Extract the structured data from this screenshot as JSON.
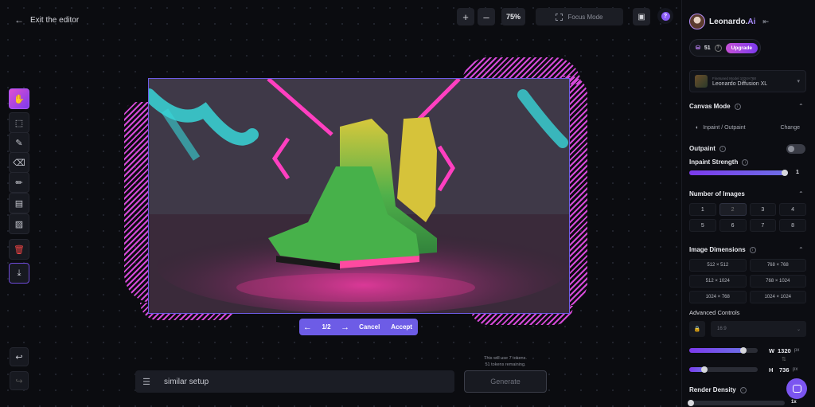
{
  "topbar": {
    "exit_label": "Exit the editor",
    "zoom_in": "+",
    "zoom_out": "–",
    "zoom_level": "75%",
    "focus_mode_label": "Focus Mode"
  },
  "toolbar": {
    "tools": [
      "pan-tool",
      "select-tool",
      "brush-tool",
      "eraser-tool",
      "pencil-tool",
      "image-upload-tool",
      "image-tool",
      "delete-tool",
      "download-tool"
    ]
  },
  "canvas": {
    "page_indicator": "1/2",
    "cancel_label": "Cancel",
    "accept_label": "Accept"
  },
  "prompt": {
    "value": "similar setup",
    "token_note_1": "This will use 7 tokens.",
    "token_note_2": "51 tokens remaining.",
    "generate_label": "Generate"
  },
  "sidebar": {
    "brand": "Leonardo.",
    "brand_suffix": "Ai",
    "tokens": "51",
    "upgrade_label": "Upgrade",
    "model_meta": "Finetuned Model   1024×768",
    "model_name": "Leonardo Diffusion XL",
    "canvas_mode": {
      "title": "Canvas Mode",
      "selected": "Inpaint / Outpaint",
      "change_label": "Change"
    },
    "outpaint": {
      "label": "Outpaint",
      "enabled": false
    },
    "inpaint_strength": {
      "label": "Inpaint Strength",
      "value": "1",
      "fraction": 1.0
    },
    "number_of_images": {
      "title": "Number of Images",
      "options": [
        "1",
        "2",
        "3",
        "4",
        "5",
        "6",
        "7",
        "8"
      ],
      "selected": "2"
    },
    "image_dimensions": {
      "title": "Image Dimensions",
      "options": [
        "512 × 512",
        "768 × 768",
        "512 × 1024",
        "768 × 1024",
        "1024 × 768",
        "1024 × 1024"
      ]
    },
    "advanced_controls": {
      "label": "Advanced Controls",
      "aspect_ratio": "16:9"
    },
    "width": {
      "label": "W",
      "value": "1320",
      "unit": "px",
      "fraction": 0.8
    },
    "height": {
      "label": "H",
      "value": "736",
      "unit": "px",
      "fraction": 0.2
    },
    "render_density": {
      "title": "Render Density",
      "value": "1x"
    }
  },
  "colors": {
    "accent": "#7c3aed",
    "accent_pink": "#d54ad8",
    "background": "#0b0c10",
    "panel": "#0c0d12"
  }
}
